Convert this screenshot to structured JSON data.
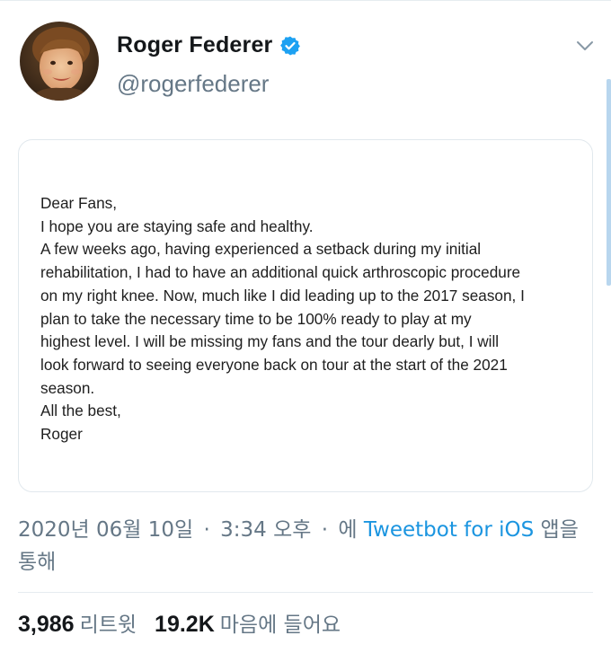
{
  "user": {
    "display_name": "Roger Federer",
    "handle": "@rogerfederer",
    "verified": true
  },
  "letter": {
    "lines": [
      "Dear Fans,",
      "I hope you are staying safe and healthy.",
      "A few weeks ago, having experienced a setback during my initial",
      "rehabilitation, I had to have an additional quick arthroscopic procedure",
      "on my right knee. Now, much like I did leading up to the 2017 season, I",
      "plan to take the necessary time to be 100% ready to play at my",
      "highest level. I will be missing my fans and the tour dearly but, I will",
      "look forward to seeing everyone back on tour at the start of the 2021",
      "season.",
      "All the best,",
      "Roger"
    ]
  },
  "meta": {
    "date": "2020년 06월 10일",
    "separator": "·",
    "time": "3:34 오후",
    "source_prefix": "에",
    "source": "Tweetbot for iOS",
    "source_suffix": "앱을 통해"
  },
  "stats": {
    "retweets_count": "3,986",
    "retweets_label": "리트윗",
    "likes_count": "19.2K",
    "likes_label": "마음에 들어요"
  },
  "colors": {
    "accent": "#1b95e0",
    "verified": "#1da1f2",
    "secondary_text": "#657786"
  },
  "icons": {
    "verified": "verified-badge-icon",
    "caret": "chevron-down-icon"
  }
}
